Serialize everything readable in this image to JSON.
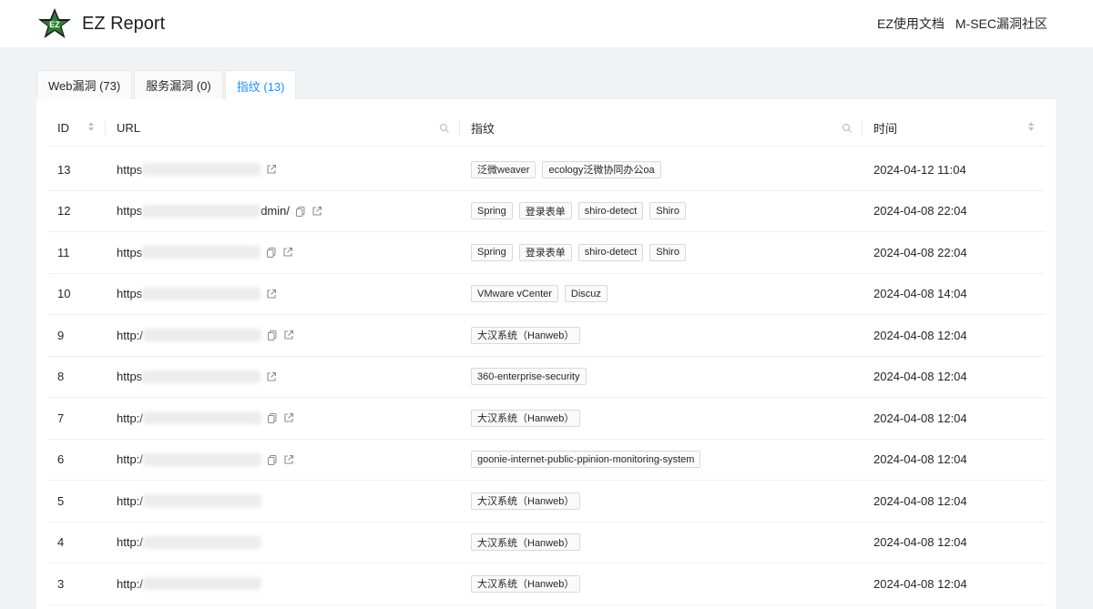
{
  "header": {
    "title": "EZ Report",
    "logo_text": "EZ",
    "nav": [
      "EZ使用文档",
      "M-SEC漏洞社区"
    ]
  },
  "tabs": [
    {
      "label": "Web漏洞 (73)",
      "active": false
    },
    {
      "label": "服务漏洞 (0)",
      "active": false
    },
    {
      "label": "指纹 (13)",
      "active": true
    }
  ],
  "colors": {
    "accent": "#1890ff",
    "logo_green": "#2e7d32",
    "logo_dark": "#1b1b1b"
  },
  "table": {
    "columns": [
      "ID",
      "URL",
      "指纹",
      "时间"
    ],
    "rows": [
      {
        "id": "13",
        "url_prefix": "https",
        "url_suffix": "",
        "has_copy": false,
        "has_ext": true,
        "tags": [
          "泛微weaver",
          "ecology泛微协同办公oa"
        ],
        "time": "2024-04-12 11:04"
      },
      {
        "id": "12",
        "url_prefix": "https",
        "url_suffix": "dmin/",
        "has_copy": true,
        "has_ext": true,
        "tags": [
          "Spring",
          "登录表单",
          "shiro-detect",
          "Shiro"
        ],
        "time": "2024-04-08 22:04"
      },
      {
        "id": "11",
        "url_prefix": "https",
        "url_suffix": "",
        "has_copy": true,
        "has_ext": true,
        "tags": [
          "Spring",
          "登录表单",
          "shiro-detect",
          "Shiro"
        ],
        "time": "2024-04-08 22:04"
      },
      {
        "id": "10",
        "url_prefix": "https",
        "url_suffix": "",
        "has_copy": false,
        "has_ext": true,
        "tags": [
          "VMware vCenter",
          "Discuz"
        ],
        "time": "2024-04-08 14:04"
      },
      {
        "id": "9",
        "url_prefix": "http:/",
        "url_suffix": "",
        "has_copy": true,
        "has_ext": true,
        "tags": [
          "大汉系统（Hanweb）"
        ],
        "time": "2024-04-08 12:04"
      },
      {
        "id": "8",
        "url_prefix": "https",
        "url_suffix": "",
        "has_copy": false,
        "has_ext": true,
        "tags": [
          "360-enterprise-security"
        ],
        "time": "2024-04-08 12:04"
      },
      {
        "id": "7",
        "url_prefix": "http:/",
        "url_suffix": "",
        "has_copy": true,
        "has_ext": true,
        "tags": [
          "大汉系统（Hanweb）"
        ],
        "time": "2024-04-08 12:04"
      },
      {
        "id": "6",
        "url_prefix": "http:/",
        "url_suffix": "",
        "has_copy": true,
        "has_ext": true,
        "tags": [
          "goonie-internet-public-ppinion-monitoring-system"
        ],
        "time": "2024-04-08 12:04"
      },
      {
        "id": "5",
        "url_prefix": "http:/",
        "url_suffix": "",
        "has_copy": false,
        "has_ext": false,
        "tags": [
          "大汉系统（Hanweb）"
        ],
        "time": "2024-04-08 12:04"
      },
      {
        "id": "4",
        "url_prefix": "http:/",
        "url_suffix": "",
        "has_copy": false,
        "has_ext": false,
        "tags": [
          "大汉系统（Hanweb）"
        ],
        "time": "2024-04-08 12:04"
      },
      {
        "id": "3",
        "url_prefix": "http:/",
        "url_suffix": "",
        "has_copy": false,
        "has_ext": false,
        "tags": [
          "大汉系统（Hanweb）"
        ],
        "time": "2024-04-08 12:04"
      }
    ]
  }
}
